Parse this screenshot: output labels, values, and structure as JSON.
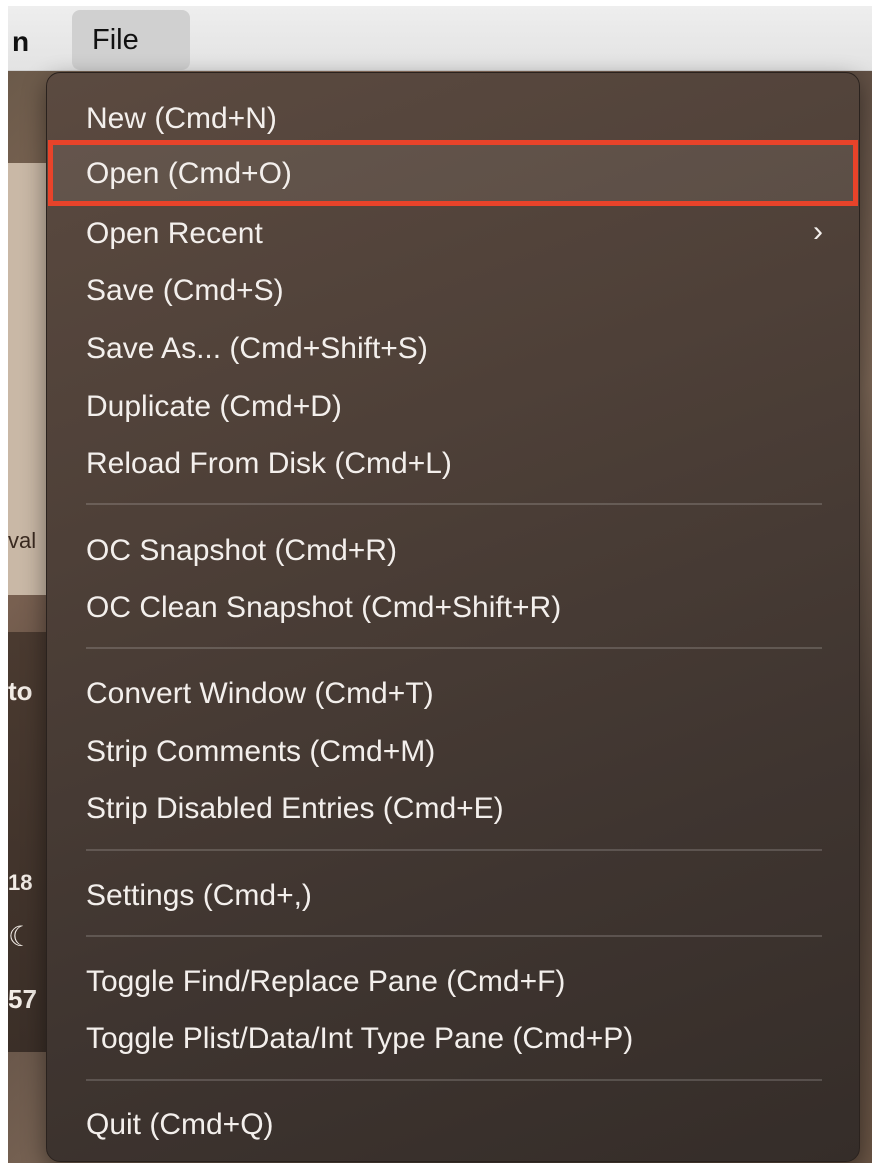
{
  "menubar": {
    "app_name_fragment": "n",
    "file_menu_label": "File"
  },
  "background": {
    "fragment_val": "val",
    "fragment_to": "to",
    "fragment_18": "18",
    "fragment_57": "57"
  },
  "file_menu": {
    "items": [
      {
        "label": "New (Cmd+N)"
      },
      {
        "label": "Open (Cmd+O)",
        "highlighted": true
      },
      {
        "label": "Open Recent",
        "submenu": true
      },
      {
        "label": "Save (Cmd+S)"
      },
      {
        "label": "Save As... (Cmd+Shift+S)"
      },
      {
        "label": "Duplicate (Cmd+D)"
      },
      {
        "label": "Reload From Disk (Cmd+L)"
      },
      {
        "label": "OC Snapshot (Cmd+R)"
      },
      {
        "label": "OC Clean Snapshot (Cmd+Shift+R)"
      },
      {
        "label": "Convert Window (Cmd+T)"
      },
      {
        "label": "Strip Comments (Cmd+M)"
      },
      {
        "label": "Strip Disabled Entries (Cmd+E)"
      },
      {
        "label": "Settings (Cmd+,)"
      },
      {
        "label": "Toggle Find/Replace Pane (Cmd+F)"
      },
      {
        "label": "Toggle Plist/Data/Int Type Pane (Cmd+P)"
      },
      {
        "label": "Quit (Cmd+Q)"
      }
    ],
    "submenu_chevron_icon": "chevron-right-icon"
  },
  "colors": {
    "highlight_outline": "#e8432a",
    "menu_text": "#f3efec"
  }
}
